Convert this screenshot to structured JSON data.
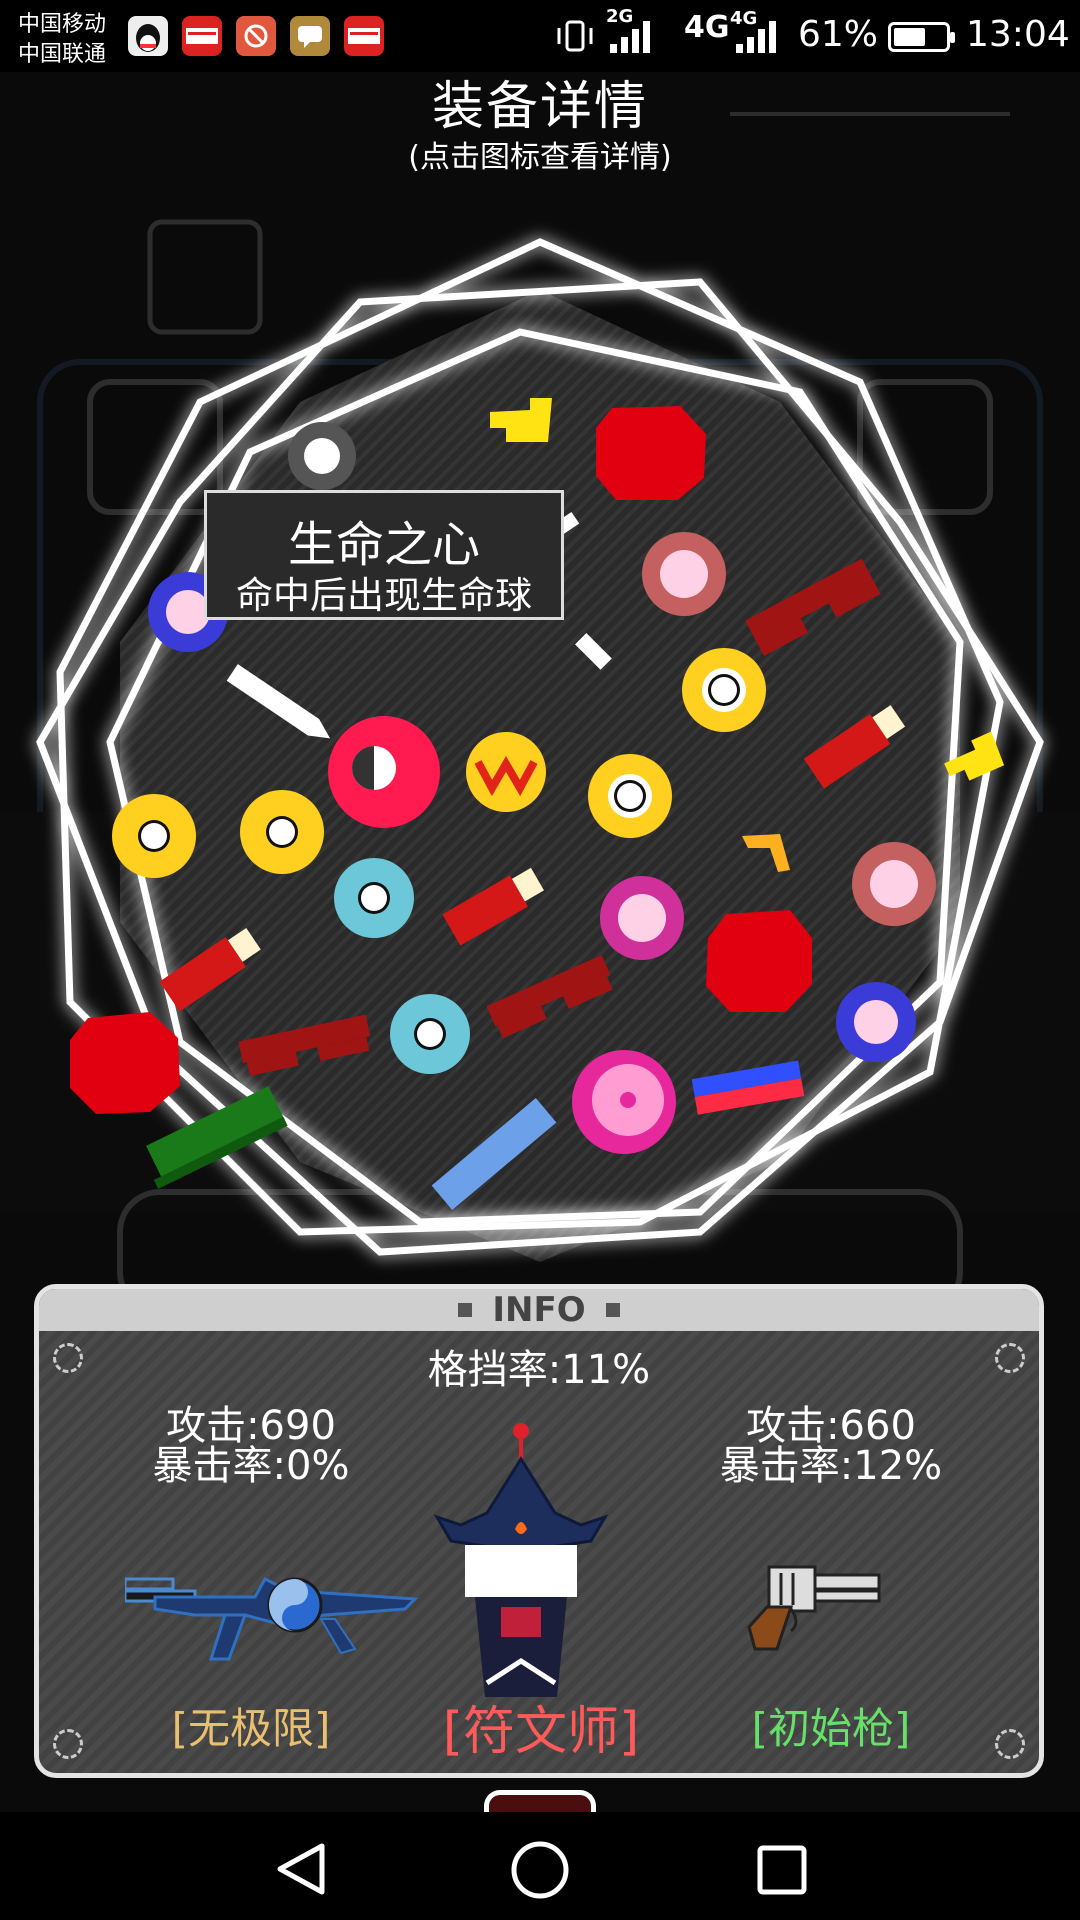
{
  "status_bar": {
    "carrier_1": "中国移动",
    "carrier_2": "中国联通",
    "net_2g": "2G",
    "net_4g_a": "4G",
    "net_4g_b": "4G",
    "battery_percent": "61%",
    "battery_level": 0.61,
    "time": "13:04"
  },
  "header": {
    "title": "装备详情",
    "subtitle": "(点击图标查看详情)"
  },
  "tooltip": {
    "item_name": "生命之心",
    "item_desc": "命中后出现生命球"
  },
  "info_panel": {
    "header": "INFO",
    "block_rate": "格挡率:11%",
    "left_weapon": {
      "attack": "攻击:690",
      "crit": "暴击率:0%",
      "name": "[无极限]",
      "name_color": "#e8c070"
    },
    "character": {
      "name": "[符文师]",
      "name_color": "#ff5a5a"
    },
    "right_weapon": {
      "attack": "攻击:660",
      "crit": "暴击率:12%",
      "name": "[初始枪]",
      "name_color": "#66e06a"
    }
  },
  "equipment_items": [
    "gear-gray-icon",
    "yellow-hand-icon",
    "red-octagon-icon",
    "pink-flower-icon",
    "red-glasses-icon",
    "red-crystal-icon",
    "yellow-ring-icon",
    "life-heart-icon",
    "yellow-medal-icon",
    "cyan-ring-icon",
    "red-stick-icon",
    "magenta-flower-icon",
    "green-bar-icon",
    "blue-bar-icon",
    "magenta-donut-icon",
    "flag-bar-icon",
    "orange-chevron-icon"
  ]
}
